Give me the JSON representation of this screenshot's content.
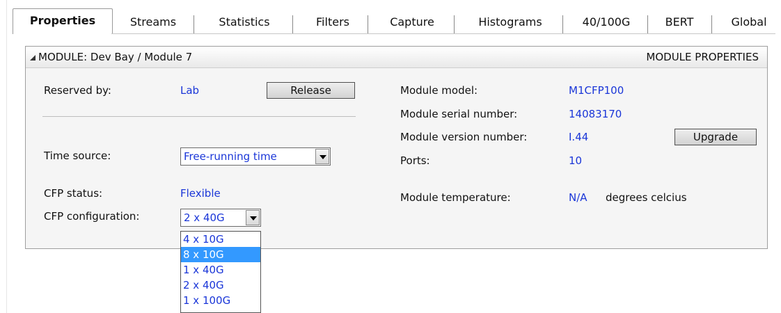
{
  "tabs": [
    {
      "label": "Properties",
      "active": true
    },
    {
      "label": "Streams"
    },
    {
      "label": "Statistics"
    },
    {
      "label": "Filters"
    },
    {
      "label": "Capture"
    },
    {
      "label": "Histograms"
    },
    {
      "label": "40/100G"
    },
    {
      "label": "BERT"
    },
    {
      "label": "Global"
    }
  ],
  "module": {
    "title": "MODULE:  Dev Bay / Module 7",
    "section": "MODULE PROPERTIES",
    "collapse_icon": "triangle-down-icon"
  },
  "left": {
    "reserved_label": "Reserved by:",
    "reserved_value": "Lab",
    "release_button": "Release",
    "time_source_label": "Time source:",
    "time_source_value": "Free-running time",
    "cfp_status_label": "CFP status:",
    "cfp_status_value": "Flexible",
    "cfp_config_label": "CFP configuration:",
    "cfp_config_value": "2 x 40G",
    "cfp_options": [
      "4 x 10G",
      "8 x 10G",
      "1 x 40G",
      "2 x 40G",
      "1 x 100G"
    ],
    "cfp_highlighted": "8 x 10G"
  },
  "right": {
    "model_label": "Module model:",
    "model_value": "M1CFP100",
    "serial_label": "Module serial number:",
    "serial_value": "14083170",
    "version_label": "Module version number:",
    "version_value": "I.44",
    "upgrade_button": "Upgrade",
    "ports_label": "Ports:",
    "ports_value": "10",
    "temp_label": "Module temperature:",
    "temp_value": "N/A",
    "temp_unit": "degrees celcius"
  },
  "colors": {
    "value_text": "#1a36d8",
    "selection": "#3399ff"
  }
}
